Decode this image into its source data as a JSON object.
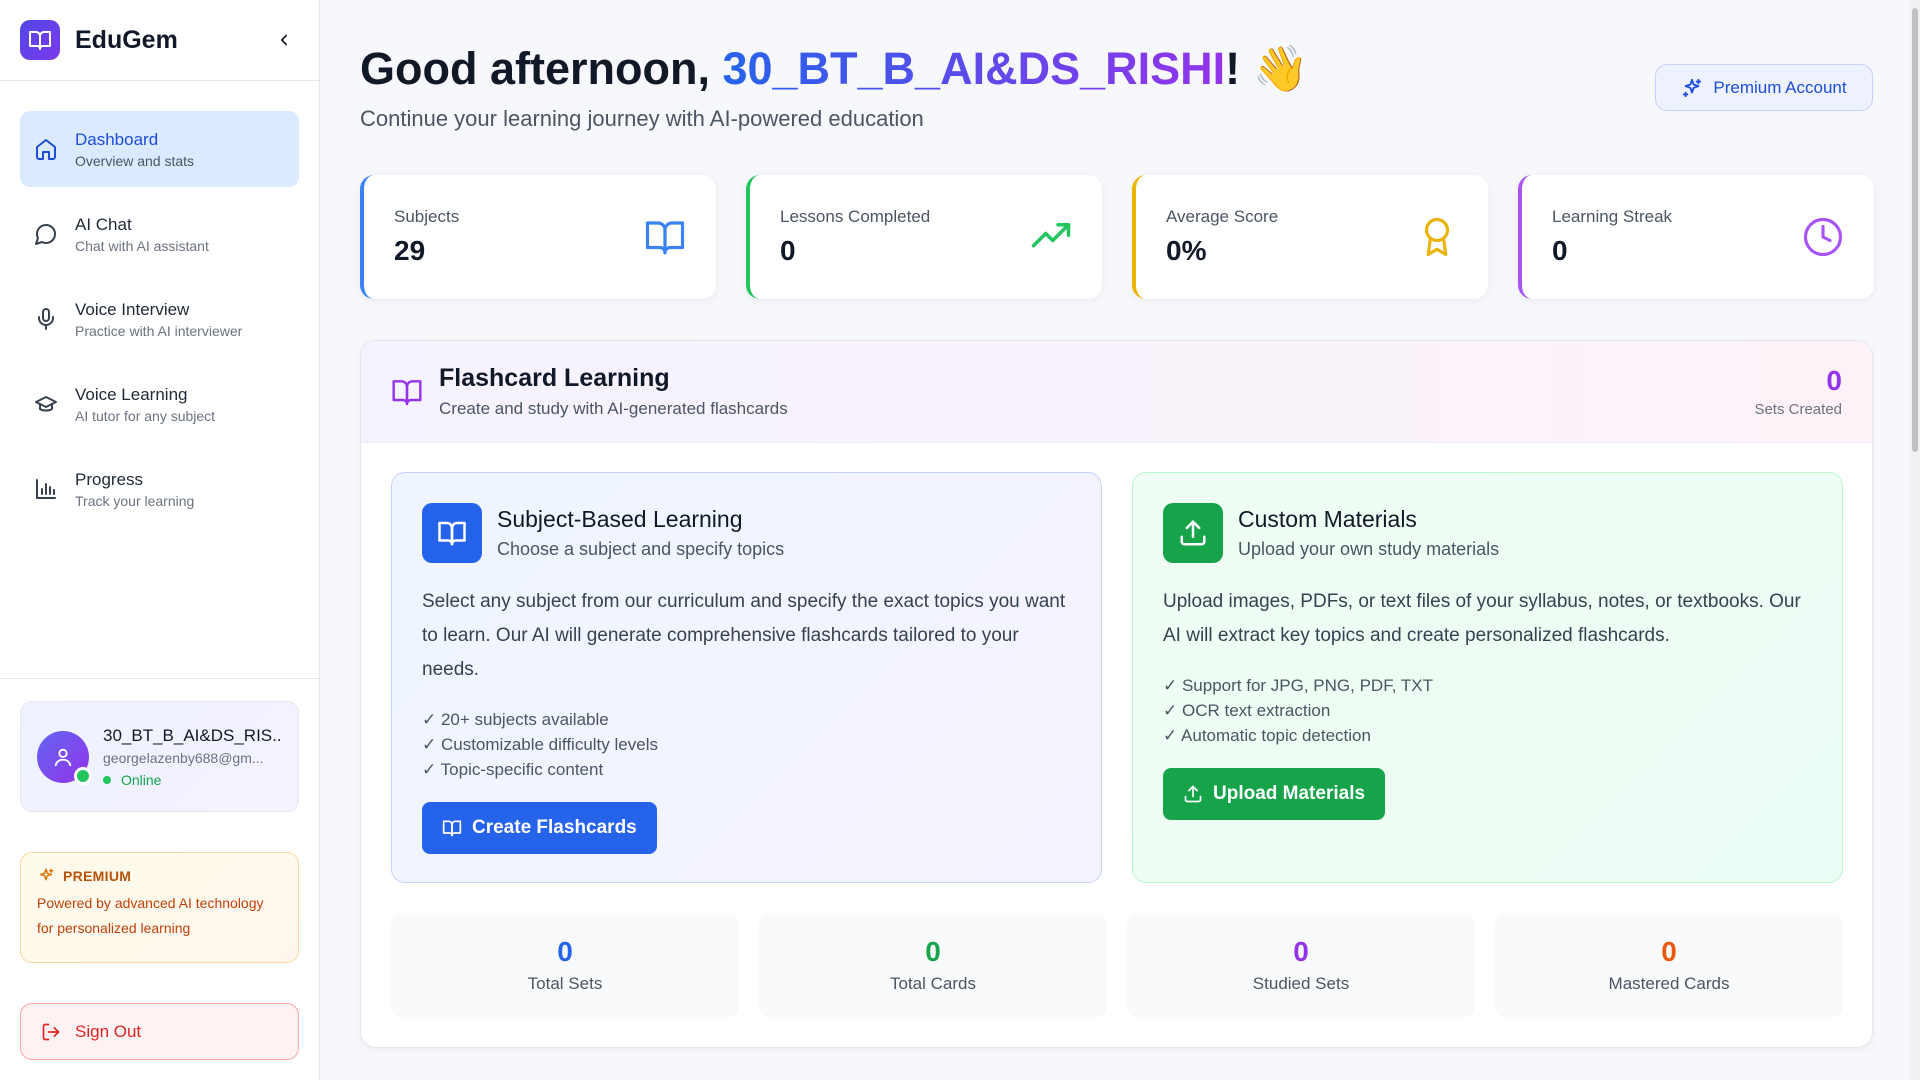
{
  "brand": {
    "name": "EduGem"
  },
  "nav": {
    "items": [
      {
        "label": "Dashboard",
        "sub": "Overview and stats",
        "icon": "home-icon",
        "active": true
      },
      {
        "label": "AI Chat",
        "sub": "Chat with AI assistant",
        "icon": "chat-bubble-icon"
      },
      {
        "label": "Voice Interview",
        "sub": "Practice with AI interviewer",
        "icon": "microphone-icon"
      },
      {
        "label": "Voice Learning",
        "sub": "AI tutor for any subject",
        "icon": "graduation-cap-icon"
      },
      {
        "label": "Progress",
        "sub": "Track your learning",
        "icon": "bar-chart-icon"
      }
    ]
  },
  "user": {
    "name": "30_BT_B_AI&DS_RIS...",
    "email": "georgelazenby688@gm...",
    "status": "Online"
  },
  "premium_box": {
    "title": "PREMIUM",
    "text": "Powered by advanced AI technology for personalized learning"
  },
  "signout": {
    "label": "Sign Out"
  },
  "header": {
    "greeting_prefix": "Good afternoon, ",
    "username": "30_BT_B_AI&DS_RISHI",
    "greeting_suffix": "! 👋",
    "subtitle": "Continue your learning journey with AI-powered education",
    "premium_button": "Premium Account"
  },
  "stats": [
    {
      "label": "Subjects",
      "value": "29",
      "color": "#3b82f6",
      "icon": "book-open-icon"
    },
    {
      "label": "Lessons Completed",
      "value": "0",
      "color": "#22c55e",
      "icon": "trending-up-icon"
    },
    {
      "label": "Average Score",
      "value": "0%",
      "color": "#eab308",
      "icon": "award-icon"
    },
    {
      "label": "Learning Streak",
      "value": "0",
      "color": "#a855f7",
      "icon": "clock-icon"
    }
  ],
  "flashcards": {
    "title": "Flashcard Learning",
    "subtitle": "Create and study with AI-generated flashcards",
    "sets_count": "0",
    "sets_label": "Sets Created",
    "subject": {
      "title": "Subject-Based Learning",
      "subtitle": "Choose a subject and specify topics",
      "description": "Select any subject from our curriculum and specify the exact topics you want to learn. Our AI will generate comprehensive flashcards tailored to your needs.",
      "features": [
        "✓ 20+ subjects available",
        "✓ Customizable difficulty levels",
        "✓ Topic-specific content"
      ],
      "button": "Create Flashcards"
    },
    "custom": {
      "title": "Custom Materials",
      "subtitle": "Upload your own study materials",
      "description": "Upload images, PDFs, or text files of your syllabus, notes, or textbooks. Our AI will extract key topics and create personalized flashcards.",
      "features": [
        "✓ Support for JPG, PNG, PDF, TXT",
        "✓ OCR text extraction",
        "✓ Automatic topic detection"
      ],
      "button": "Upload Materials"
    },
    "summary": [
      {
        "value": "0",
        "label": "Total Sets",
        "color": "#2563eb"
      },
      {
        "value": "0",
        "label": "Total Cards",
        "color": "#16a34a"
      },
      {
        "value": "0",
        "label": "Studied Sets",
        "color": "#9333ea"
      },
      {
        "value": "0",
        "label": "Mastered Cards",
        "color": "#ea580c"
      }
    ]
  }
}
